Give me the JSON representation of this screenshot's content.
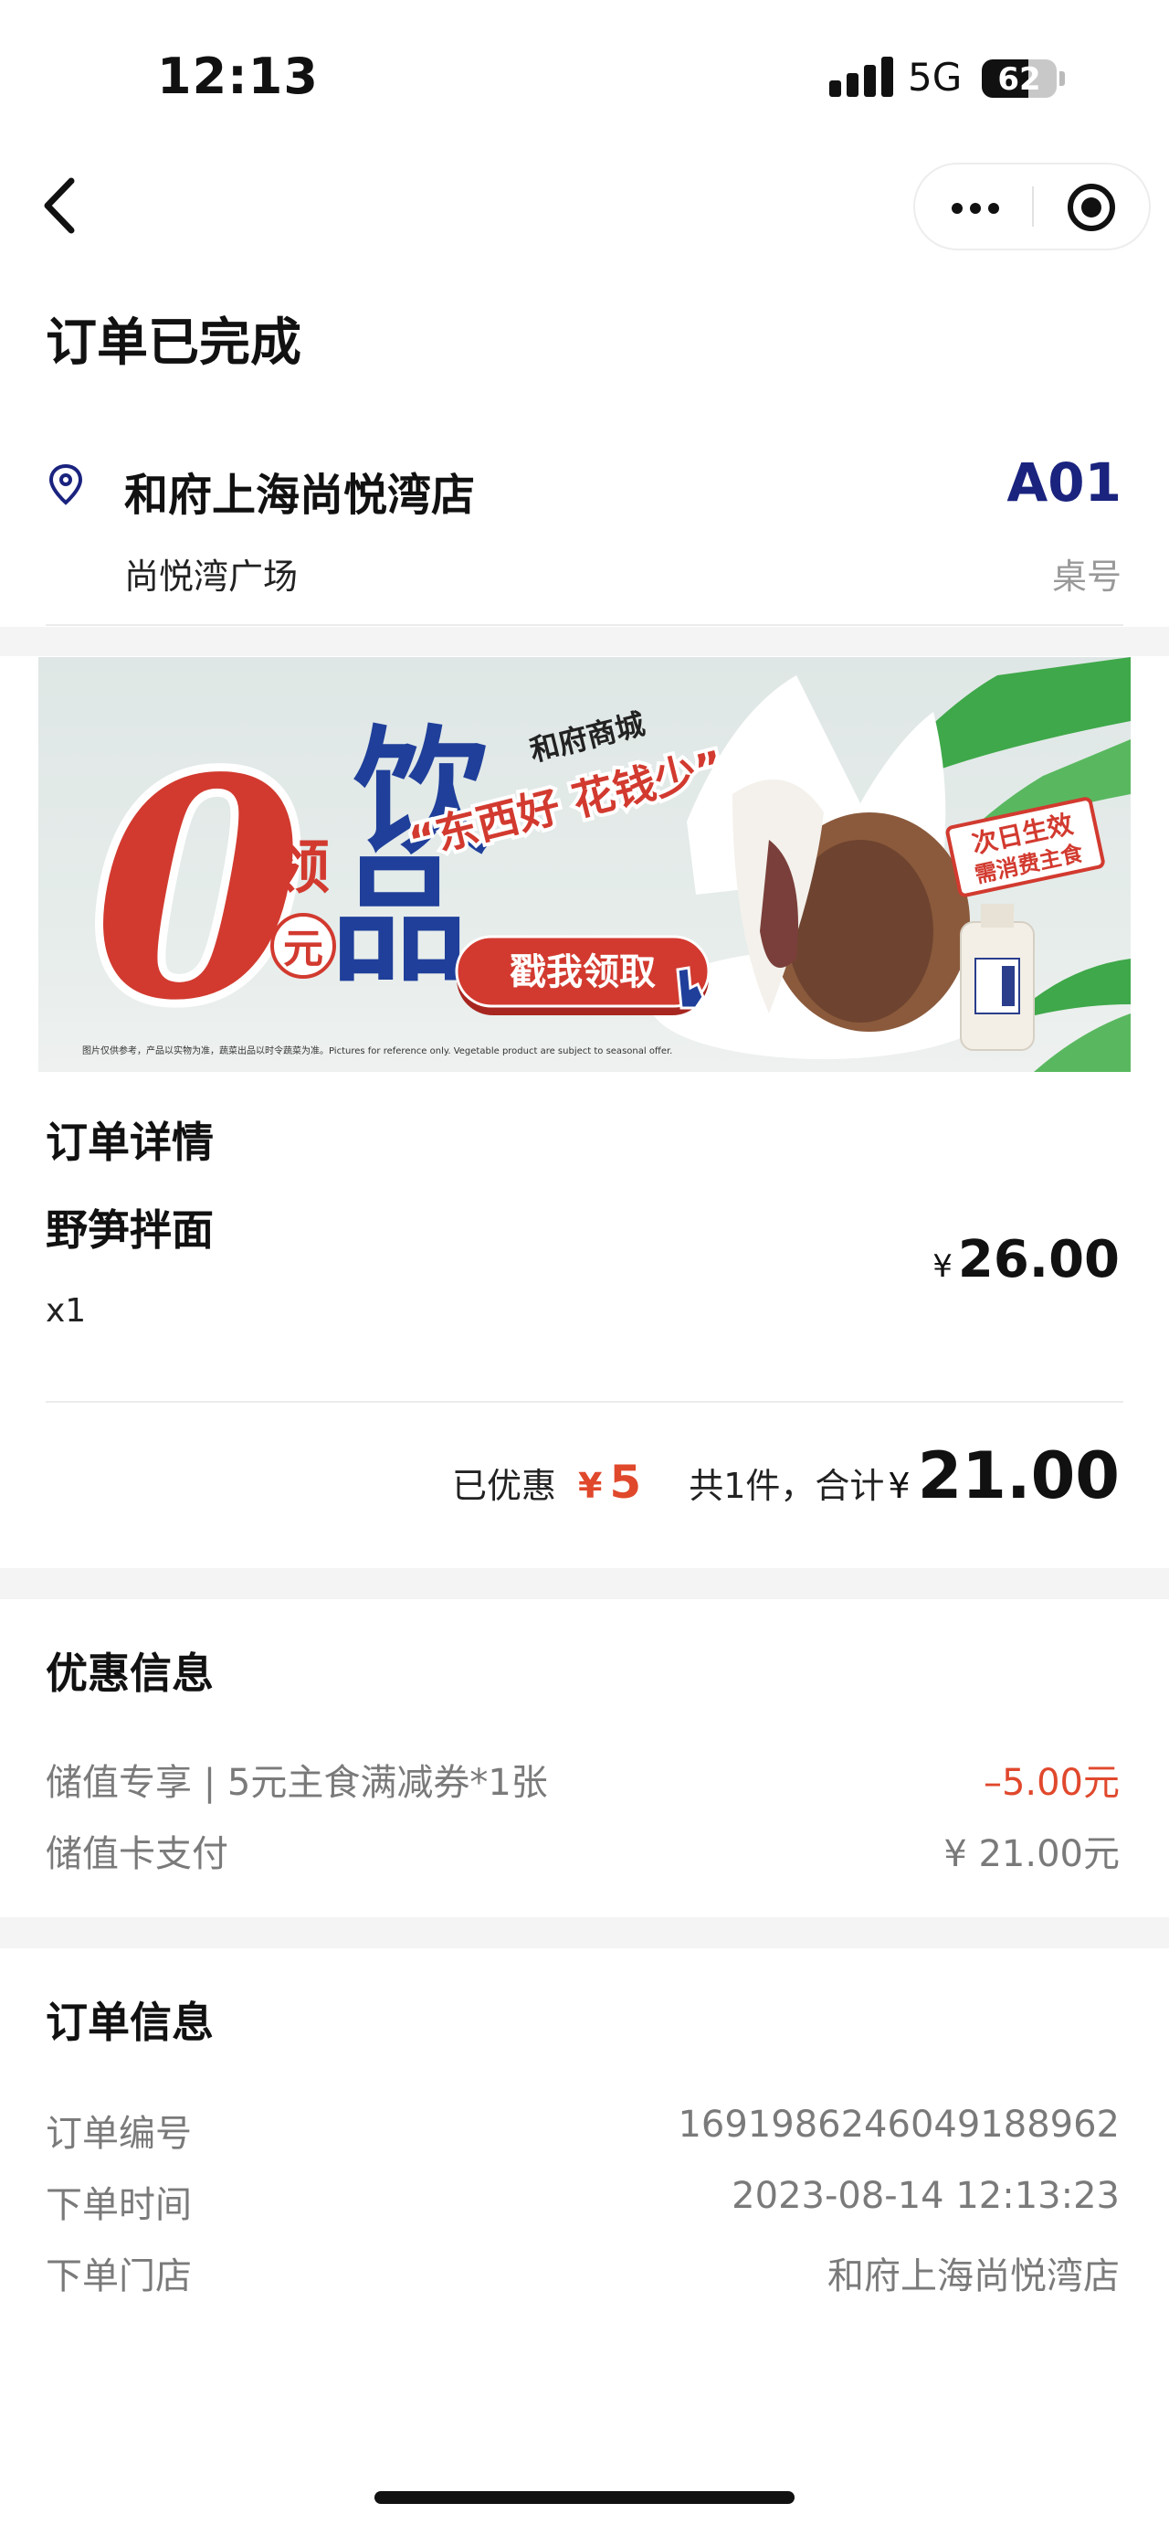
{
  "status_bar": {
    "time": "12:13",
    "network": "5G",
    "battery": "62",
    "battery_level": 0.62
  },
  "nav": {
    "back_icon": "chevron-left-icon",
    "more_icon": "more-dots-icon",
    "close_icon": "target-close-icon"
  },
  "page_title": "订单已完成",
  "store": {
    "name": "和府上海尚悦湾店",
    "area": "尚悦湾广场",
    "table_number": "A01",
    "table_label": "桌号"
  },
  "banner": {
    "big_zero": "0",
    "side_text_1": "领",
    "side_text_2": "元",
    "headline_1": "饮",
    "headline_2": "品",
    "brand": "和府商城",
    "slogan": "“东西好 花钱少”",
    "cta": "戳我领取",
    "stamp_1": "次日生效",
    "stamp_2": "需消费主食",
    "disclaimer": "图片仅供参考，产品以实物为准，蔬菜出品以时令蔬菜为准。Pictures for reference only. Vegetable product are subject to seasonal offer."
  },
  "order_details": {
    "title": "订单详情",
    "item": {
      "name": "野笋拌面",
      "quantity": "x1",
      "currency": "¥",
      "price": "26.00"
    },
    "summary": {
      "discount_label": "已优惠",
      "discount_currency": "¥",
      "discount_value": "5",
      "total_label": "共1件，合计",
      "currency": "¥",
      "total": "21.00"
    }
  },
  "discount_info": {
    "title": "优惠信息",
    "rows": [
      {
        "label": "储值专享 | 5元主食满减券*1张",
        "value": "–5.00元"
      },
      {
        "label": "储值卡支付",
        "value": "¥ 21.00元"
      }
    ]
  },
  "order_info": {
    "title": "订单信息",
    "rows": [
      {
        "label": "订单编号",
        "value": "1691986246049188962"
      },
      {
        "label": "下单时间",
        "value": "2023-08-14 12:13:23"
      },
      {
        "label": "下单门店",
        "value": "和府上海尚悦湾店"
      }
    ]
  },
  "colors": {
    "accent_red": "#e0482c",
    "table_blue": "#1a237e",
    "muted_text": "#7a7a7a",
    "divider_bg": "#f4f4f4"
  }
}
